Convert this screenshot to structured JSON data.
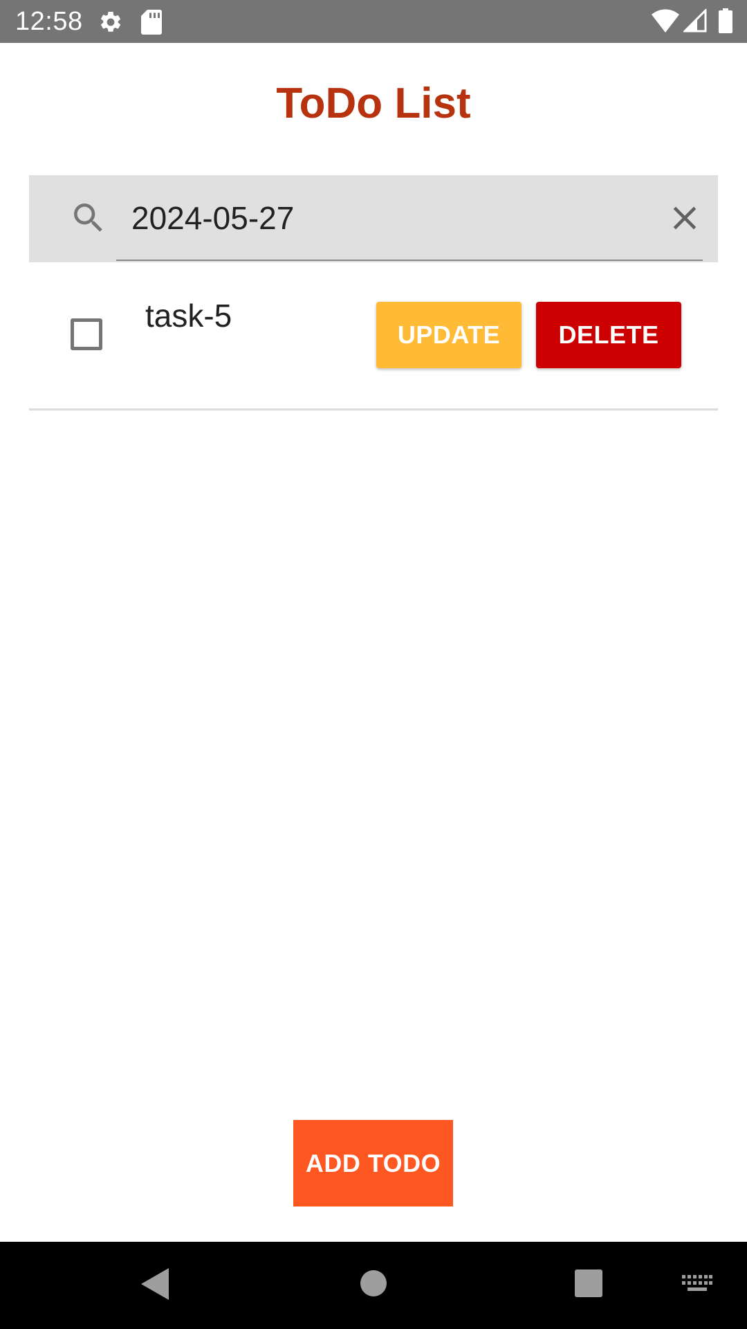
{
  "status_bar": {
    "time": "12:58",
    "icons": [
      "gear-icon",
      "sd-card-icon",
      "wifi-icon",
      "signal-icon",
      "battery-icon"
    ]
  },
  "header": {
    "title": "ToDo List"
  },
  "search": {
    "value": "2024-05-27",
    "icon": "search-icon",
    "clear_icon": "close-icon"
  },
  "todos": [
    {
      "label": "task-5",
      "checked": false,
      "update_label": "UPDATE",
      "delete_label": "DELETE"
    }
  ],
  "footer": {
    "add_label": "ADD TODO"
  },
  "nav_bar": {
    "icons": [
      "back-icon",
      "home-icon",
      "recents-icon",
      "keyboard-icon"
    ]
  },
  "colors": {
    "title": "#b7320f",
    "status_bar": "#757575",
    "search_bg": "#e0e0e0",
    "update_button": "#ffbb36",
    "delete_button": "#cc0000",
    "add_button": "#ff5722",
    "nav_bar": "#000000"
  }
}
